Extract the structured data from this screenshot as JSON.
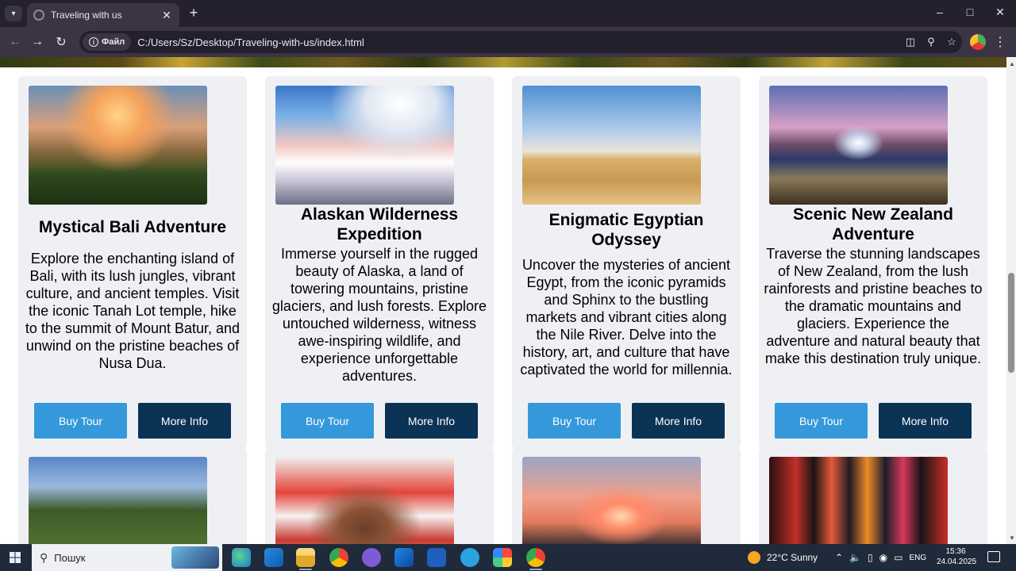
{
  "browser": {
    "tab_title": "Traveling with us",
    "site_chip": "Файл",
    "url": "C:/Users/Sz/Desktop/Traveling-with-us/index.html",
    "icons": [
      "tab-list-icon",
      "close-icon",
      "plus-icon",
      "minimize-icon",
      "maximize-icon",
      "window-close-icon",
      "back-icon",
      "forward-icon",
      "reload-icon",
      "info-icon",
      "translate-icon",
      "zoom-icon",
      "star-icon",
      "profile-icon",
      "menu-icon"
    ]
  },
  "tours": [
    {
      "title": "Mystical Bali Adventure",
      "description": "Explore the enchanting island of Bali, with its lush jungles, vibrant culture, and ancient temples. Visit the iconic Tanah Lot temple, hike to the summit of Mount Batur, and unwind on the pristine beaches of Nusa Dua.",
      "buy_label": "Buy Tour",
      "info_label": "More Info"
    },
    {
      "title": "Alaskan Wilderness Expedition",
      "description": "Immerse yourself in the rugged beauty of Alaska, a land of towering mountains, pristine glaciers, and lush forests. Explore untouched wilderness, witness awe-inspiring wildlife, and experience unforgettable adventures.",
      "buy_label": "Buy Tour",
      "info_label": "More Info"
    },
    {
      "title": "Enigmatic Egyptian Odyssey",
      "description": "Uncover the mysteries of ancient Egypt, from the iconic pyramids and Sphinx to the bustling markets and vibrant cities along the Nile River. Delve into the history, art, and culture that have captivated the world for millennia.",
      "buy_label": "Buy Tour",
      "info_label": "More Info"
    },
    {
      "title": "Scenic New Zealand Adventure",
      "description": "Traverse the stunning landscapes of New Zealand, from the lush rainforests and pristine beaches to the dramatic mountains and glaciers. Experience the adventure and natural beauty that make this destination truly unique.",
      "buy_label": "Buy Tour",
      "info_label": "More Info"
    }
  ],
  "taskbar": {
    "search_placeholder": "Пошук",
    "weather": "22°C  Sunny",
    "language": "ENG",
    "time": "15:36",
    "date": "24.04.2025"
  },
  "colors": {
    "buy_button": "#3498db",
    "info_button": "#0b3356",
    "card_background": "#eff0f4"
  }
}
